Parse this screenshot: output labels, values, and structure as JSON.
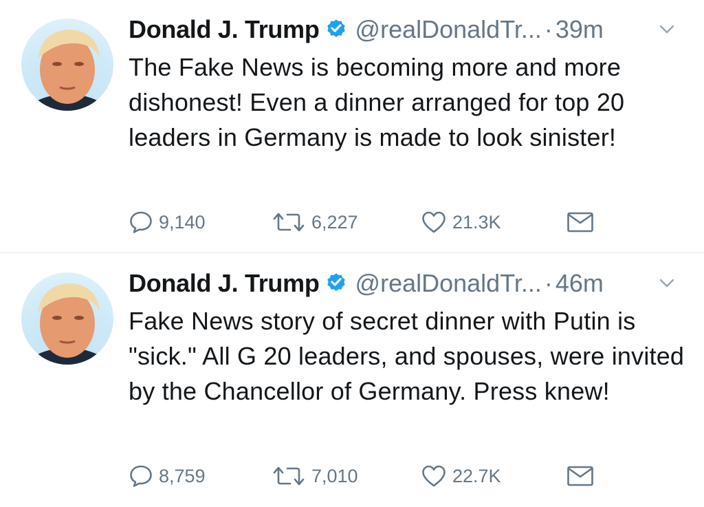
{
  "colors": {
    "text": "#14171a",
    "muted": "#657786",
    "verified": "#1da1f2",
    "divider": "#e1e8ed"
  },
  "tweets": [
    {
      "author_name": "Donald J. Trump",
      "handle": "@realDonaldTr...",
      "separator": "·",
      "time": "39m",
      "verified_icon": "verified-badge-icon",
      "text": "The Fake News is becoming more and more dishonest! Even a dinner arranged for top 20 leaders in Germany is made to look sinister!",
      "replies": "9,140",
      "retweets": "6,227",
      "likes": "21.3K"
    },
    {
      "author_name": "Donald J. Trump",
      "handle": "@realDonaldTr...",
      "separator": "·",
      "time": "46m",
      "verified_icon": "verified-badge-icon",
      "text": "Fake News story of secret dinner with Putin is \"sick.\" All G 20 leaders, and spouses, were invited by the Chancellor of Germany. Press knew!",
      "replies": "8,759",
      "retweets": "7,010",
      "likes": "22.7K"
    }
  ]
}
